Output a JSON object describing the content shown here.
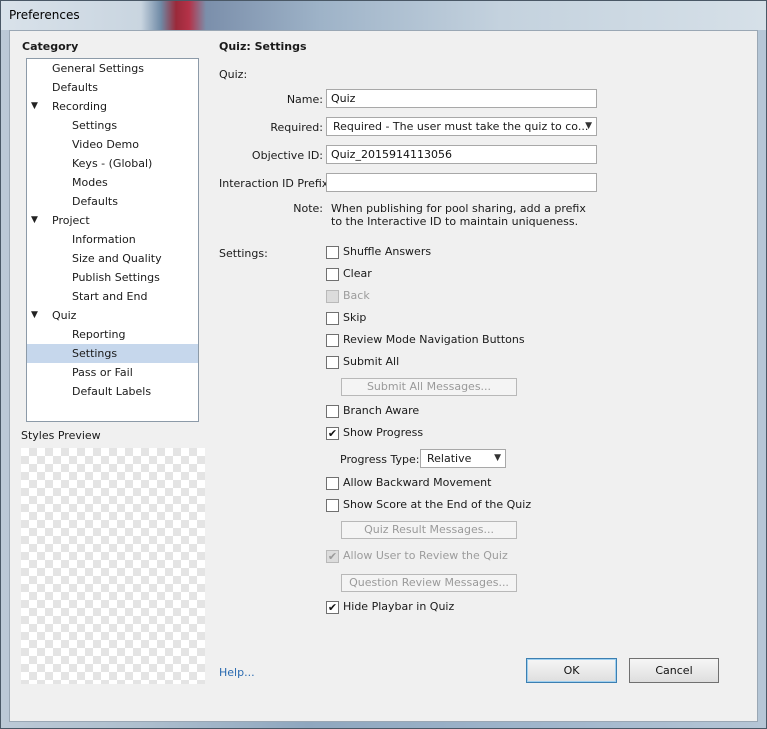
{
  "window": {
    "title": "Preferences"
  },
  "category": {
    "header": "Category",
    "items": [
      {
        "label": "General Settings",
        "level": 0,
        "expanded": null,
        "selected": false
      },
      {
        "label": "Defaults",
        "level": 0,
        "expanded": null,
        "selected": false
      },
      {
        "label": "Recording",
        "level": 0,
        "expanded": true,
        "selected": false
      },
      {
        "label": "Settings",
        "level": 1,
        "expanded": null,
        "selected": false
      },
      {
        "label": "Video Demo",
        "level": 1,
        "expanded": null,
        "selected": false
      },
      {
        "label": "Keys - (Global)",
        "level": 1,
        "expanded": null,
        "selected": false
      },
      {
        "label": "Modes",
        "level": 1,
        "expanded": null,
        "selected": false
      },
      {
        "label": "Defaults",
        "level": 1,
        "expanded": null,
        "selected": false
      },
      {
        "label": "Project",
        "level": 0,
        "expanded": true,
        "selected": false
      },
      {
        "label": "Information",
        "level": 1,
        "expanded": null,
        "selected": false
      },
      {
        "label": "Size and Quality",
        "level": 1,
        "expanded": null,
        "selected": false
      },
      {
        "label": "Publish Settings",
        "level": 1,
        "expanded": null,
        "selected": false
      },
      {
        "label": "Start and End",
        "level": 1,
        "expanded": null,
        "selected": false
      },
      {
        "label": "Quiz",
        "level": 0,
        "expanded": true,
        "selected": false
      },
      {
        "label": "Reporting",
        "level": 1,
        "expanded": null,
        "selected": false
      },
      {
        "label": "Settings",
        "level": 1,
        "expanded": null,
        "selected": true
      },
      {
        "label": "Pass or Fail",
        "level": 1,
        "expanded": null,
        "selected": false
      },
      {
        "label": "Default Labels",
        "level": 1,
        "expanded": null,
        "selected": false
      }
    ]
  },
  "styles_preview": {
    "label": "Styles Preview"
  },
  "panel": {
    "title": "Quiz: Settings",
    "quiz_section_label": "Quiz:",
    "name": {
      "label": "Name:",
      "value": "Quiz"
    },
    "required": {
      "label": "Required:",
      "value": "Required - The user must take the quiz to co..."
    },
    "objective_id": {
      "label": "Objective ID:",
      "value": "Quiz_2015914113056"
    },
    "interaction_prefix": {
      "label": "Interaction ID Prefix:",
      "value": ""
    },
    "note": {
      "label": "Note:",
      "line1": "When publishing for pool sharing, add a prefix",
      "line2": "to the Interactive ID to maintain uniqueness."
    },
    "settings_label": "Settings:",
    "options": {
      "shuffle_answers": {
        "label": "Shuffle Answers",
        "checked": false,
        "enabled": true
      },
      "clear": {
        "label": "Clear",
        "checked": false,
        "enabled": true
      },
      "back": {
        "label": "Back",
        "checked": false,
        "enabled": false
      },
      "skip": {
        "label": "Skip",
        "checked": false,
        "enabled": true
      },
      "review_nav": {
        "label": "Review Mode Navigation Buttons",
        "checked": false,
        "enabled": true
      },
      "submit_all": {
        "label": "Submit All",
        "checked": false,
        "enabled": true
      },
      "branch_aware": {
        "label": "Branch Aware",
        "checked": false,
        "enabled": true
      },
      "show_progress": {
        "label": "Show Progress",
        "checked": true,
        "enabled": true
      },
      "allow_backward": {
        "label": "Allow Backward Movement",
        "checked": false,
        "enabled": true
      },
      "show_score": {
        "label": "Show Score at the End of the Quiz",
        "checked": false,
        "enabled": true
      },
      "allow_review": {
        "label": "Allow User to Review the Quiz",
        "checked": true,
        "enabled": false
      },
      "hide_playbar": {
        "label": "Hide Playbar in Quiz",
        "checked": true,
        "enabled": true
      }
    },
    "submit_all_messages": "Submit All Messages...",
    "progress_type": {
      "label": "Progress Type:",
      "value": "Relative"
    },
    "quiz_result_messages": "Quiz Result Messages...",
    "question_review_messages": "Question Review Messages..."
  },
  "footer": {
    "help": "Help...",
    "ok": "OK",
    "cancel": "Cancel"
  },
  "icons": {
    "check": "check-icon",
    "expand": "expand-triangle-icon",
    "dropdown": "chevron-down-icon"
  }
}
